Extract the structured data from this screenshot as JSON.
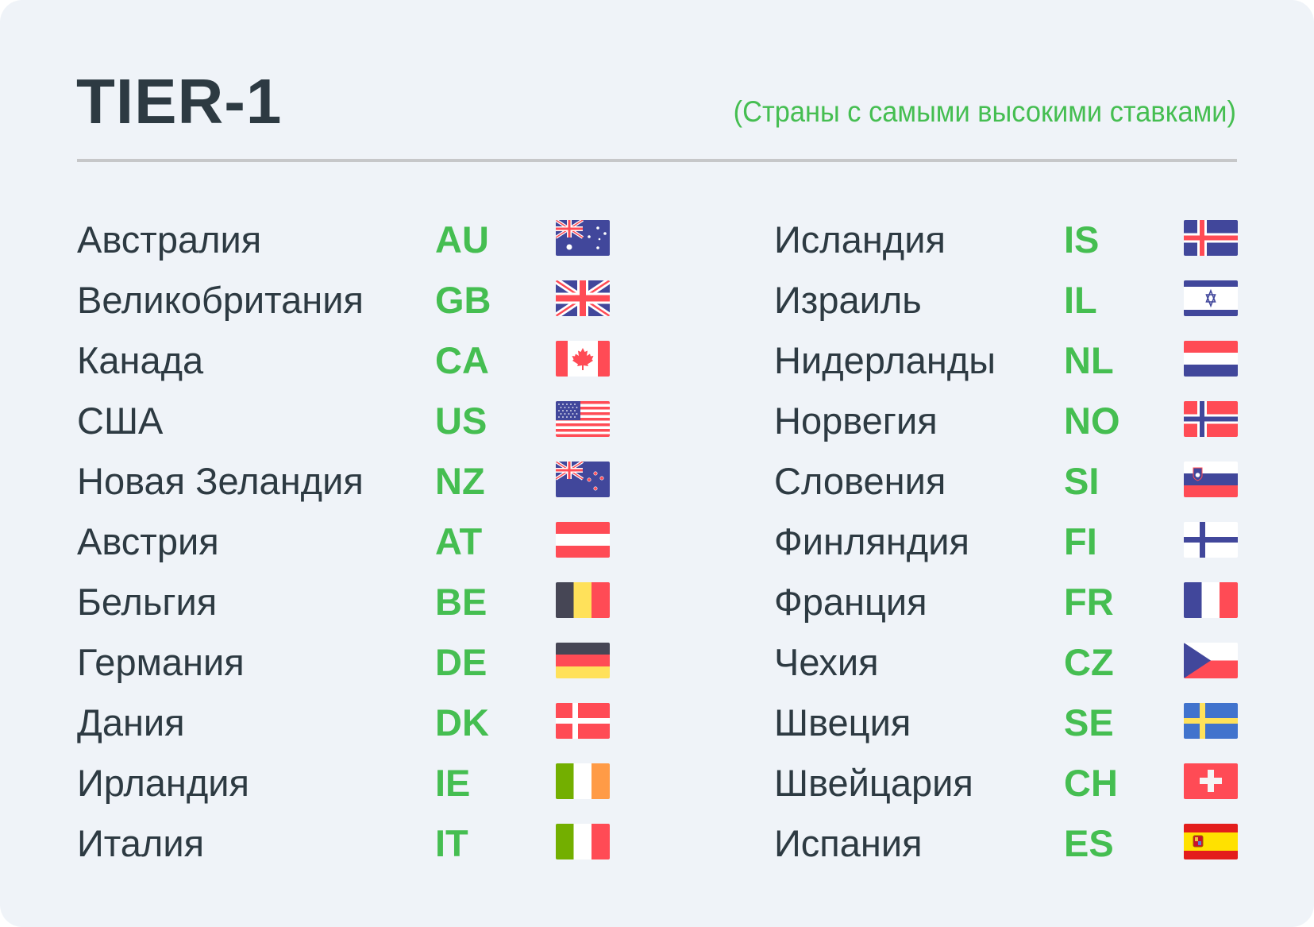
{
  "header": {
    "title": "TIER-1",
    "subtitle": "(Страны с самыми высокими ставками)"
  },
  "colors": {
    "text": "#2d3a42",
    "accent_green": "#45be51",
    "background": "#eff3f8",
    "divider": "#c6c7c9"
  },
  "countries_left": [
    {
      "name": "Австралия",
      "code": "AU",
      "flag_icon": "flag-australia-icon"
    },
    {
      "name": "Великобритания",
      "code": "GB",
      "flag_icon": "flag-united-kingdom-icon"
    },
    {
      "name": "Канада",
      "code": "CA",
      "flag_icon": "flag-canada-icon"
    },
    {
      "name": "США",
      "code": "US",
      "flag_icon": "flag-usa-icon"
    },
    {
      "name": "Новая Зеландия",
      "code": "NZ",
      "flag_icon": "flag-new-zealand-icon"
    },
    {
      "name": "Австрия",
      "code": "AT",
      "flag_icon": "flag-austria-icon"
    },
    {
      "name": "Бельгия",
      "code": "BE",
      "flag_icon": "flag-belgium-icon"
    },
    {
      "name": "Германия",
      "code": "DE",
      "flag_icon": "flag-germany-icon"
    },
    {
      "name": "Дания",
      "code": "DK",
      "flag_icon": "flag-denmark-icon"
    },
    {
      "name": "Ирландия",
      "code": "IE",
      "flag_icon": "flag-ireland-icon"
    },
    {
      "name": "Италия",
      "code": "IT",
      "flag_icon": "flag-italy-icon"
    }
  ],
  "countries_right": [
    {
      "name": "Исландия",
      "code": "IS",
      "flag_icon": "flag-iceland-icon"
    },
    {
      "name": "Израиль",
      "code": "IL",
      "flag_icon": "flag-israel-icon"
    },
    {
      "name": "Нидерланды",
      "code": "NL",
      "flag_icon": "flag-netherlands-icon"
    },
    {
      "name": "Норвегия",
      "code": "NO",
      "flag_icon": "flag-norway-icon"
    },
    {
      "name": "Словения",
      "code": "SI",
      "flag_icon": "flag-slovenia-icon"
    },
    {
      "name": "Финляндия",
      "code": "FI",
      "flag_icon": "flag-finland-icon"
    },
    {
      "name": "Франция",
      "code": "FR",
      "flag_icon": "flag-france-icon"
    },
    {
      "name": "Чехия",
      "code": "CZ",
      "flag_icon": "flag-czechia-icon"
    },
    {
      "name": "Швеция",
      "code": "SE",
      "flag_icon": "flag-sweden-icon"
    },
    {
      "name": "Швейцария",
      "code": "CH",
      "flag_icon": "flag-switzerland-icon"
    },
    {
      "name": "Испания",
      "code": "ES",
      "flag_icon": "flag-spain-icon"
    }
  ]
}
